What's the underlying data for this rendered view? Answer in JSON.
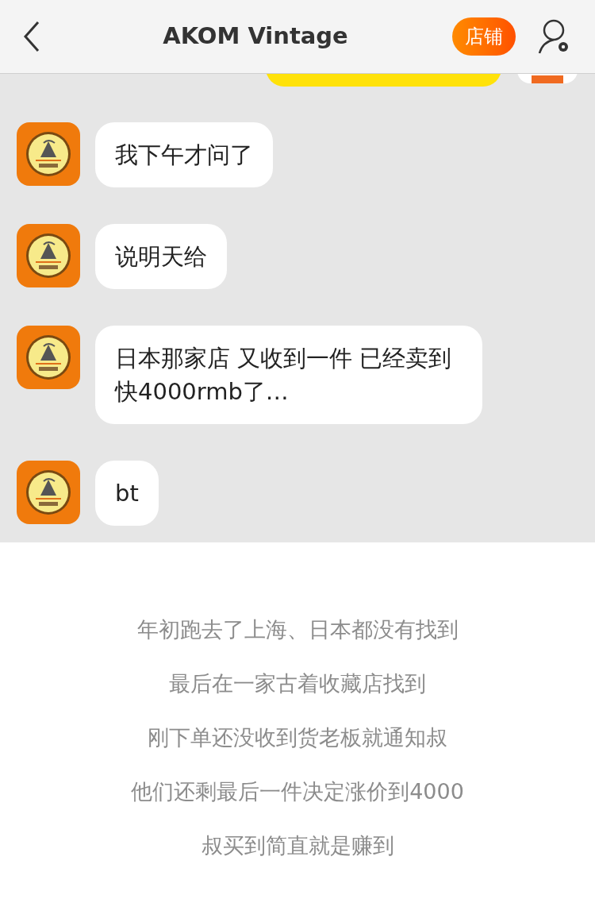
{
  "header": {
    "title": "AKOM Vintage",
    "shop_button": "店铺"
  },
  "messages": [
    {
      "text": "我下午才问了"
    },
    {
      "text": "说明天给"
    },
    {
      "text": "日本那家店 又收到一件 已经卖到快4000rmb了…"
    },
    {
      "text": "bt"
    }
  ],
  "caption": [
    "年初跑去了上海、日本都没有找到",
    "最后在一家古着收藏店找到",
    "刚下单还没收到货老板就通知叔",
    "他们还剩最后一件决定涨价到4000",
    "叔买到简直就是赚到"
  ]
}
